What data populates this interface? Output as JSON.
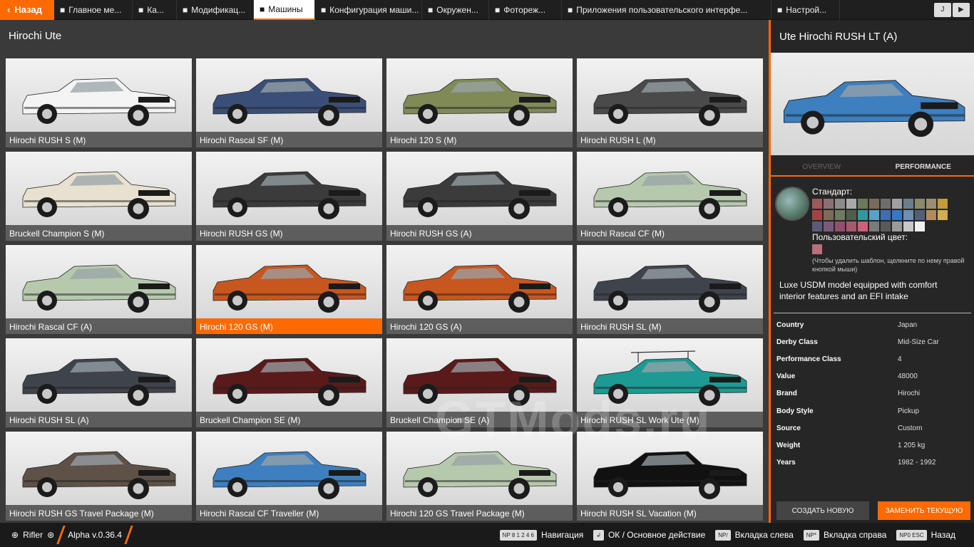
{
  "topbar": {
    "back_label": "Назад",
    "tabs": [
      {
        "label": "Главное ме...",
        "icon": "grid-icon"
      },
      {
        "label": "Ка...",
        "icon": "map-icon"
      },
      {
        "label": "Модификац...",
        "icon": "puzzle-icon"
      },
      {
        "label": "Машины",
        "icon": "car-icon",
        "active": true
      },
      {
        "label": "Конфигурация маши...",
        "icon": "engine-icon"
      },
      {
        "label": "Окружен...",
        "icon": "weather-icon"
      },
      {
        "label": "Фотореж...",
        "icon": "camera-icon"
      },
      {
        "label": "Приложения пользовательского интерфе...",
        "icon": "apps-icon"
      },
      {
        "label": "Настрой...",
        "icon": "sliders-icon"
      }
    ],
    "right_key": "J"
  },
  "left": {
    "title": "Hirochi Ute",
    "vehicles": [
      {
        "name": "Hirochi RUSH S (M)",
        "color": "#f4f4f4"
      },
      {
        "name": "Hirochi Rascal SF (M)",
        "color": "#3a4f78"
      },
      {
        "name": "Hirochi 120 S (M)",
        "color": "#7f8a57"
      },
      {
        "name": "Hirochi RUSH L (M)",
        "color": "#4a4a4a"
      },
      {
        "name": "Bruckell Champion S (M)",
        "color": "#e8e1cf"
      },
      {
        "name": "Hirochi RUSH GS (M)",
        "color": "#3b3b3b"
      },
      {
        "name": "Hirochi RUSH GS (A)",
        "color": "#3b3b3b"
      },
      {
        "name": "Hirochi Rascal CF (M)",
        "color": "#b7c9ad"
      },
      {
        "name": "Hirochi Rascal CF (A)",
        "color": "#b7c9ad"
      },
      {
        "name": "Hirochi 120 GS (M)",
        "color": "#c8561f",
        "selected": true
      },
      {
        "name": "Hirochi 120 GS (A)",
        "color": "#c8561f"
      },
      {
        "name": "Hirochi RUSH SL (M)",
        "color": "#3f434c"
      },
      {
        "name": "Hirochi RUSH SL (A)",
        "color": "#3f434c"
      },
      {
        "name": "Bruckell Champion SE (M)",
        "color": "#5a1a1a"
      },
      {
        "name": "Bruckell Champion SE (A)",
        "color": "#5a1a1a"
      },
      {
        "name": "Hirochi RUSH SL Work Ute (M)",
        "color": "#1d9a94"
      },
      {
        "name": "Hirochi RUSH GS Travel Package (M)",
        "color": "#5e5147"
      },
      {
        "name": "Hirochi Rascal CF Traveller (M)",
        "color": "#3d7fbf"
      },
      {
        "name": "Hirochi 120 GS Travel Package (M)",
        "color": "#b7c9ad"
      },
      {
        "name": "Hirochi RUSH SL Vacation (M)",
        "color": "#111111"
      }
    ],
    "watermark": "GTMods.ru"
  },
  "right": {
    "title": "Ute Hirochi RUSH LT (A)",
    "preview_color": "#3d7fbf",
    "tabs": [
      "OVERVIEW",
      "PERFORMANCE"
    ],
    "standard_label": "Стандарт:",
    "swatches": [
      "#9b5a5a",
      "#8a7070",
      "#8b8b8b",
      "#aaaaaa",
      "#6c7a5a",
      "#7a6a5a",
      "#6e6e6e",
      "#a0a0a0",
      "#6b7e8c",
      "#8a8a6a",
      "#9f8d6f",
      "#c49a3a",
      "#a34444",
      "#7d6b5b",
      "#6d7b62",
      "#4f5d4a",
      "#2a9c9c",
      "#5aa0c8",
      "#3f6fae",
      "#3579c4",
      "#6d8fb1",
      "#555e79",
      "#b58a5a",
      "#cfae56",
      "#5b5b77",
      "#7a5a7a",
      "#944e6a",
      "#a85a6d",
      "#cf5f7a",
      "#7a7a7a",
      "#5a5a5a",
      "#9a9a9a",
      "#c9c9c9",
      "#f0f0f0"
    ],
    "custom_label": "Пользовательский цвет:",
    "custom_color": "#b7707a",
    "hint": "(Чтобы удалить шаблон, щелкните по нему правой кнопкой мыши)",
    "description": "Luxe USDM model equipped with comfort interior features and an EFI intake",
    "stats": [
      {
        "k": "Country",
        "v": "Japan"
      },
      {
        "k": "Derby Class",
        "v": "Mid-Size Car"
      },
      {
        "k": "Performance Class",
        "v": "4"
      },
      {
        "k": "Value",
        "v": "48000"
      },
      {
        "k": "Brand",
        "v": "Hirochi"
      },
      {
        "k": "Body Style",
        "v": "Pickup"
      },
      {
        "k": "Source",
        "v": "Custom"
      },
      {
        "k": "Weight",
        "v": "1 205 kg"
      },
      {
        "k": "Years",
        "v": "1982 - 1992"
      }
    ],
    "create_new": "СОЗДАТЬ НОВУЮ",
    "replace_current": "ЗАМЕНИТЬ ТЕКУЩУЮ"
  },
  "bottom": {
    "user": "Rifler",
    "version": "Alpha v.0.36.4",
    "hints": [
      {
        "key": "NP 8 1 2 4 6",
        "label": "Навигация"
      },
      {
        "key": "↲",
        "label": "ОК / Основное действие"
      },
      {
        "key": "NP/",
        "label": "Вкладка слева"
      },
      {
        "key": "NP*",
        "label": "Вкладка справа"
      },
      {
        "key": "NP0  ESC",
        "label": "Назад"
      }
    ]
  }
}
